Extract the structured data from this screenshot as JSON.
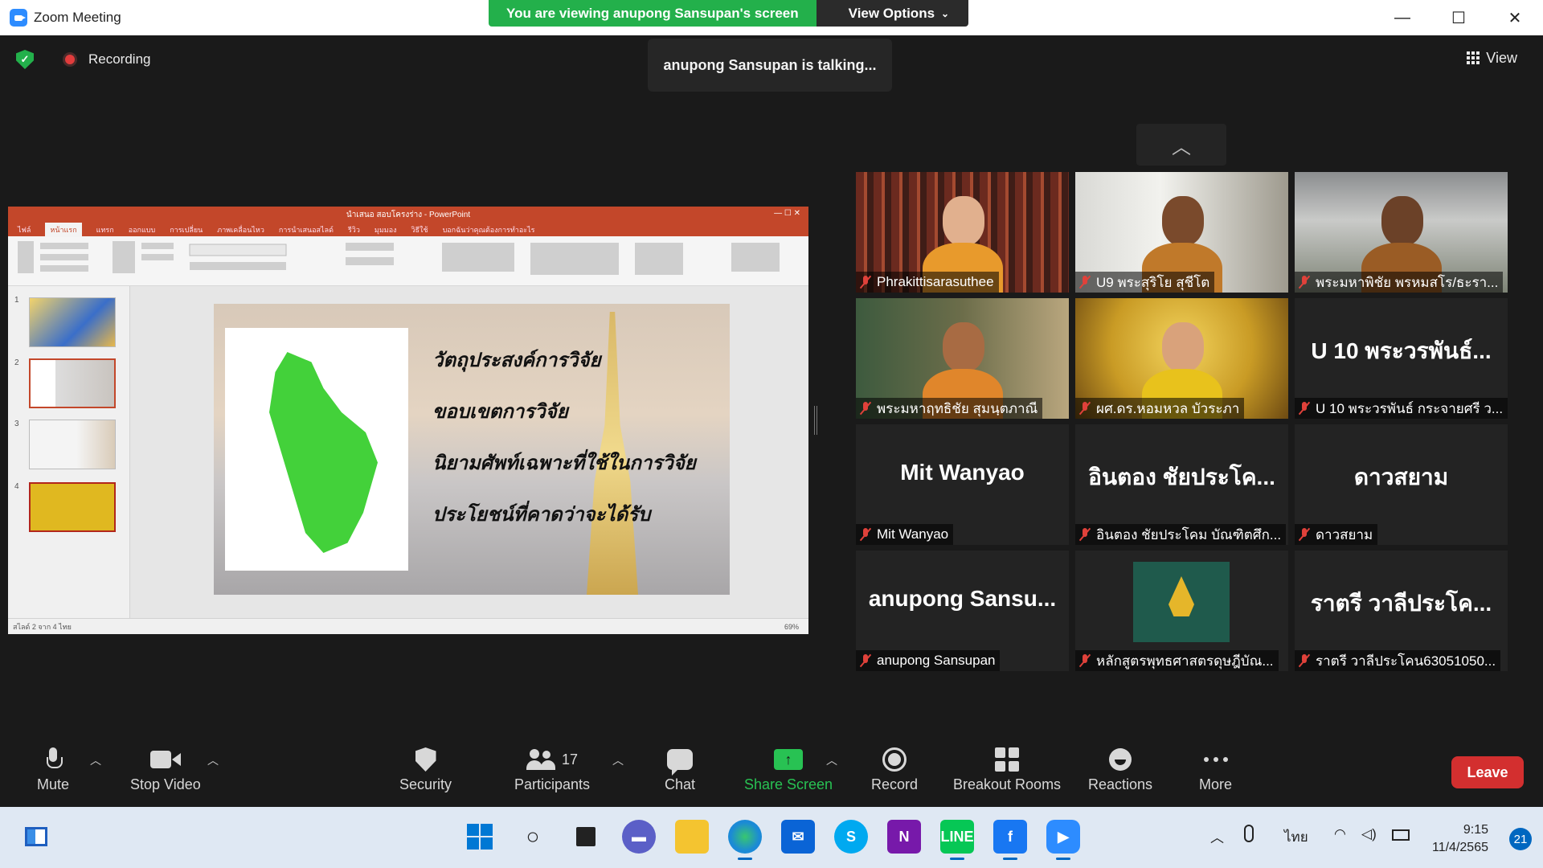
{
  "window": {
    "title": "Zoom Meeting",
    "share_banner": "You are viewing anupong Sansupan's screen",
    "view_options": "View Options",
    "minimize": "—",
    "maximize": "☐",
    "close": "✕"
  },
  "status": {
    "recording_label": "Recording",
    "talking": "anupong Sansupan is talking...",
    "view_label": "View"
  },
  "shared_screen": {
    "ppt_title": "นำเสนอ สอบโครงร่าง - PowerPoint",
    "ppt_tabs": [
      "ไฟล์",
      "หน้าแรก",
      "แทรก",
      "ออกแบบ",
      "การเปลี่ยน",
      "ภาพเคลื่อนไหว",
      "การนำเสนอสไลด์",
      "รีวิว",
      "มุมมอง",
      "วิธีใช้",
      "บอกฉันว่าคุณต้องการทำอะไร"
    ],
    "slide_numbers": [
      "1",
      "2",
      "3",
      "4"
    ],
    "slide_lines": [
      "วัตถุประสงค์การวิจัย",
      "ขอบเขตการวิจัย",
      "นิยามศัพท์เฉพาะที่ใช้ในการวิจัย",
      "ประโยชน์ที่คาดว่าจะได้รับ"
    ],
    "status_text": "สไลด์ 2 จาก 4   ไทย",
    "zoom_text": "69%"
  },
  "gallery": {
    "tiles": [
      {
        "name": "Phrakittisarasuthee",
        "big": ""
      },
      {
        "name": "U9 พระสุริโย สุชีโต",
        "big": ""
      },
      {
        "name": "พระมหาพิชัย พรหมสโร/ธะรา...",
        "big": ""
      },
      {
        "name": "พระมหาฤทธิชัย สุมนฺตภาณี",
        "big": ""
      },
      {
        "name": "ผศ.ดร.หอมหวล บัวระภา",
        "big": ""
      },
      {
        "name": "U 10 พระวรพันธ์ กระจายศรี ว...",
        "big": "U 10 พระวรพันธ์..."
      },
      {
        "name": "Mit Wanyao",
        "big": "Mit Wanyao"
      },
      {
        "name": "อินตอง ชัยประโคม บัณฑิตศึก...",
        "big": "อินตอง ชัยประโค..."
      },
      {
        "name": "ดาวสยาม",
        "big": "ดาวสยาม"
      },
      {
        "name": "anupong Sansupan",
        "big": "anupong Sansu..."
      },
      {
        "name": "หลักสูตรพุทธศาสตรดุษฎีบัณ...",
        "big": ""
      },
      {
        "name": "ราตรี วาลีประโคน63051050...",
        "big": "ราตรี วาลีประโค..."
      }
    ]
  },
  "toolbar": {
    "mute": "Mute",
    "stop_video": "Stop Video",
    "security": "Security",
    "participants": "Participants",
    "participants_count": "17",
    "chat": "Chat",
    "share_screen": "Share Screen",
    "record": "Record",
    "breakout_rooms": "Breakout Rooms",
    "reactions": "Reactions",
    "more": "More",
    "leave": "Leave"
  },
  "taskbar": {
    "language": "ไทย",
    "time": "9:15",
    "date": "11/4/2565",
    "notifications": "21"
  },
  "colors": {
    "share_green": "#23b04b",
    "leave_red": "#d32f2f",
    "muted_red": "#e0413a",
    "ppt_red": "#c3472a"
  }
}
